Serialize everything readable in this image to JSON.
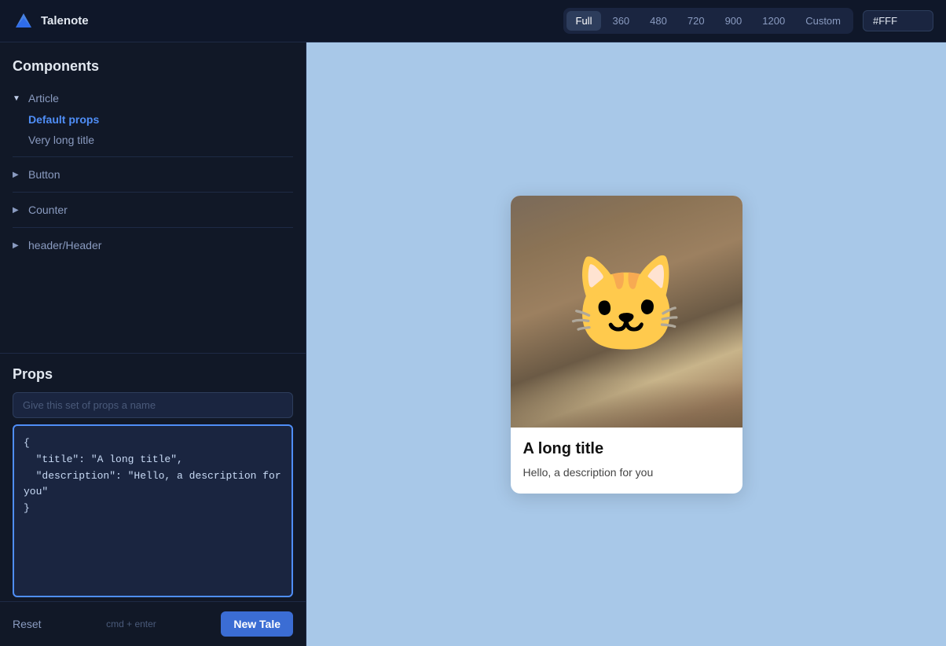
{
  "app": {
    "logo_text": "Talenote"
  },
  "topbar": {
    "viewport_buttons": [
      {
        "label": "Full",
        "active": true
      },
      {
        "label": "360",
        "active": false
      },
      {
        "label": "480",
        "active": false
      },
      {
        "label": "720",
        "active": false
      },
      {
        "label": "900",
        "active": false
      },
      {
        "label": "1200",
        "active": false
      },
      {
        "label": "Custom",
        "active": false
      }
    ],
    "color_value": "#FFF"
  },
  "sidebar": {
    "components_title": "Components",
    "tree": [
      {
        "label": "Article",
        "expanded": true,
        "children": [
          {
            "label": "Default props",
            "active": true
          },
          {
            "label": "Very long title",
            "active": false
          }
        ]
      },
      {
        "label": "Button",
        "expanded": false
      },
      {
        "label": "Counter",
        "expanded": false
      },
      {
        "label": "header/Header",
        "expanded": false
      }
    ]
  },
  "props": {
    "title": "Props",
    "name_placeholder": "Give this set of props a name",
    "textarea_value": "{\n  \"title\": \"A long title\",\n  \"description\": \"Hello, a description for you\"\n}"
  },
  "footer": {
    "reset_label": "Reset",
    "shortcut": "cmd + enter",
    "new_tale_label": "New Tale"
  },
  "preview": {
    "card": {
      "title": "A long title",
      "description": "Hello, a description for you"
    }
  }
}
